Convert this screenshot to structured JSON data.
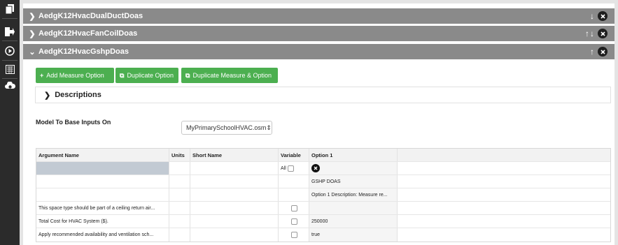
{
  "measures": [
    {
      "name": "AedgK12HvacDualDuctDoas",
      "expanded": false,
      "arrows": "↓"
    },
    {
      "name": "AedgK12HvacFanCoilDoas",
      "expanded": false,
      "arrows": "↑↓"
    },
    {
      "name": "AedgK12HvacGshpDoas",
      "expanded": true,
      "arrows": "↑"
    }
  ],
  "buttons": {
    "add_measure_option": "Add Measure Option",
    "duplicate_option": "Duplicate Option",
    "duplicate_measure_option": "Duplicate Measure & Option"
  },
  "descriptions_label": "Descriptions",
  "model": {
    "label": "Model To Base Inputs On",
    "selected": "MyPrimarySchoolHVAC.osm"
  },
  "table": {
    "headers": [
      "Argument Name",
      "Units",
      "Short Name",
      "Variable",
      "Option 1"
    ],
    "all_label": "All",
    "rows": [
      {
        "argument": "",
        "units": "",
        "short": "",
        "variable": "",
        "option1": "GSHP DOAS"
      },
      {
        "argument": "",
        "units": "",
        "short": "",
        "variable": "",
        "option1": "Option 1 Description: Measure re..."
      },
      {
        "argument": "This space type should be part of a ceiling return air...",
        "units": "",
        "short": "",
        "variable": "checkbox",
        "option1": ""
      },
      {
        "argument": "Total Cost for HVAC System ($).",
        "units": "",
        "short": "",
        "variable": "checkbox",
        "option1": "250000"
      },
      {
        "argument": "Apply recommended availability and ventilation sch...",
        "units": "",
        "short": "",
        "variable": "checkbox",
        "option1": "true"
      }
    ]
  },
  "colors": {
    "header_gray": "#8a8a8a",
    "green": "#4caf50",
    "sidebar": "#2b2b2b"
  }
}
